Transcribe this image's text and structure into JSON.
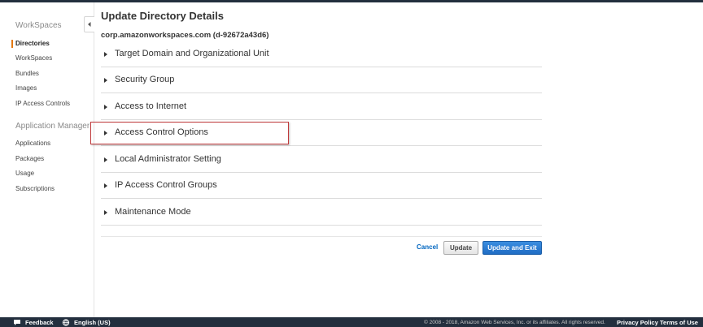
{
  "sidebar": {
    "group1_title": "WorkSpaces",
    "group1_items": [
      "Directories",
      "WorkSpaces",
      "Bundles",
      "Images",
      "IP Access Controls"
    ],
    "group2_title": "Application Manager",
    "group2_items": [
      "Applications",
      "Packages",
      "Usage",
      "Subscriptions"
    ],
    "active_item": "Directories"
  },
  "main": {
    "title": "Update Directory Details",
    "directory_id": "corp.amazonworkspaces.com (d-92672a43d6)",
    "sections": [
      "Target Domain and Organizational Unit",
      "Security Group",
      "Access to Internet",
      "Access Control Options",
      "Local Administrator Setting",
      "IP Access Control Groups",
      "Maintenance Mode"
    ],
    "highlighted_section": "Access Control Options"
  },
  "actions": {
    "cancel": "Cancel",
    "update": "Update",
    "update_exit": "Update and Exit"
  },
  "footer": {
    "feedback": "Feedback",
    "language": "English (US)",
    "copyright": "© 2008 - 2018, Amazon Web Services, Inc. or its affiliates. All rights reserved.",
    "privacy": "Privacy Policy",
    "terms": "Terms of Use"
  },
  "colors": {
    "accent_orange": "#e47911",
    "primary_blue": "#1f6cc4",
    "link_blue": "#0066c0",
    "footer_bg": "#232f3e",
    "highlight_red": "#c0393b"
  },
  "icons": {
    "collapse": "chevron-left-icon",
    "section": "caret-right-icon",
    "feedback": "speech-bubble-icon",
    "language": "globe-icon"
  }
}
